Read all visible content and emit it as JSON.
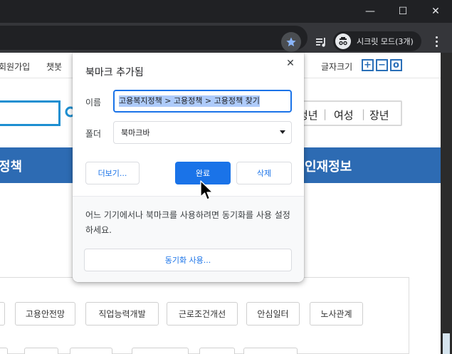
{
  "window": {
    "minimize": "—",
    "maximize": "☐",
    "close": "✕"
  },
  "toolbar": {
    "star_icon": "star-icon",
    "playlist_icon": "playlist-icon",
    "incognito_label": "시크릿 모드(3개)"
  },
  "page": {
    "nav": [
      "회원가입",
      "챗봇",
      "글자크기"
    ],
    "keywords": [
      "청년",
      "여성",
      "장년"
    ],
    "bluebar": [
      "정책",
      "인재정보"
    ],
    "tags": [
      "고용안전망",
      "직업능력개발",
      "근로조건개선",
      "안심일터",
      "노사관계"
    ]
  },
  "bookmark": {
    "title": "북마크 추가됨",
    "name_label": "이름",
    "name_value": "고용복지정책 > 고용정책 > 고용정책 찾기",
    "folder_label": "폴더",
    "folder_value": "북마크바",
    "more_button": "더보기...",
    "done_button": "완료",
    "remove_button": "삭제",
    "sync_text": "어느 기기에서나 북마크를 사용하려면 동기화를 사용 설정하세요.",
    "sync_button": "동기화 사용..."
  },
  "colors": {
    "accent": "#1a73e8",
    "site_blue": "#2d6bb3"
  }
}
